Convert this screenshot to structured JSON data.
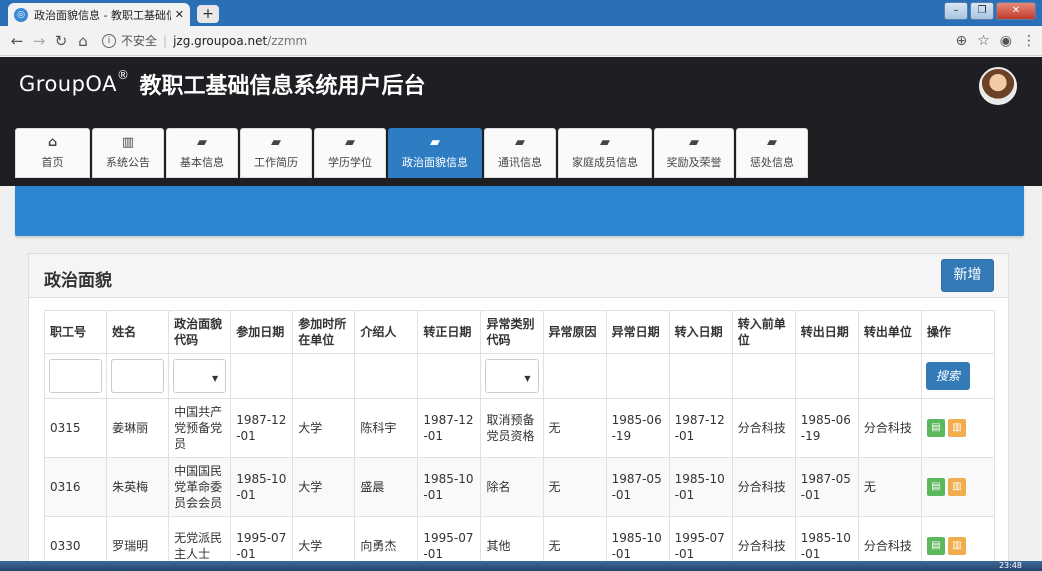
{
  "browser": {
    "tab_title": "政治面貌信息 - 教职工基础信息系",
    "url_security": "不安全",
    "url_host": "jzg.groupoa.net",
    "url_path": "/zzmm"
  },
  "header": {
    "logo": "GroupOA",
    "logo_mark": "®",
    "title": "教职工基础信息系统用户后台"
  },
  "nav": {
    "items": [
      {
        "label": "首页",
        "icon": "home-icon",
        "glyph": "⌂"
      },
      {
        "label": "系统公告",
        "icon": "chart-icon",
        "glyph": "▥"
      },
      {
        "label": "基本信息",
        "icon": "book-icon",
        "glyph": "▰"
      },
      {
        "label": "工作简历",
        "icon": "book-icon",
        "glyph": "▰"
      },
      {
        "label": "学历学位",
        "icon": "book-icon",
        "glyph": "▰"
      },
      {
        "label": "政治面貌信息",
        "icon": "book-icon",
        "glyph": "▰"
      },
      {
        "label": "通讯信息",
        "icon": "book-icon",
        "glyph": "▰"
      },
      {
        "label": "家庭成员信息",
        "icon": "book-icon",
        "glyph": "▰"
      },
      {
        "label": "奖励及荣誉",
        "icon": "book-icon",
        "glyph": "▰"
      },
      {
        "label": "惩处信息",
        "icon": "book-icon",
        "glyph": "▰"
      }
    ],
    "active_index": 5
  },
  "panel": {
    "title": "政治面貌",
    "add_label": "新增"
  },
  "table": {
    "columns": [
      "职工号",
      "姓名",
      "政治面貌代码",
      "参加日期",
      "参加时所在单位",
      "介绍人",
      "转正日期",
      "异常类别代码",
      "异常原因",
      "异常日期",
      "转入日期",
      "转入前单位",
      "转出日期",
      "转出单位",
      "操作"
    ],
    "search_label": "搜索",
    "rows": [
      [
        "0315",
        "姜琳丽",
        "中国共产党预备党员",
        "1987-12-01",
        "大学",
        "陈科宇",
        "1987-12-01",
        "取消预备党员资格",
        "无",
        "1985-06-19",
        "1987-12-01",
        "分合科技",
        "1985-06-19",
        "分合科技"
      ],
      [
        "0316",
        "朱英梅",
        "中国国民党革命委员会会员",
        "1985-10-01",
        "大学",
        "盛晨",
        "1985-10-01",
        "除名",
        "无",
        "1987-05-01",
        "1985-10-01",
        "分合科技",
        "1987-05-01",
        "无"
      ],
      [
        "0330",
        "罗瑞明",
        "无党派民主人士",
        "1995-07-01",
        "大学",
        "向勇杰",
        "1995-07-01",
        "其他",
        "无",
        "1985-10-01",
        "1995-07-01",
        "分合科技",
        "1985-10-01",
        "分合科技"
      ]
    ]
  },
  "taskbar": {
    "clock": "23:48"
  }
}
